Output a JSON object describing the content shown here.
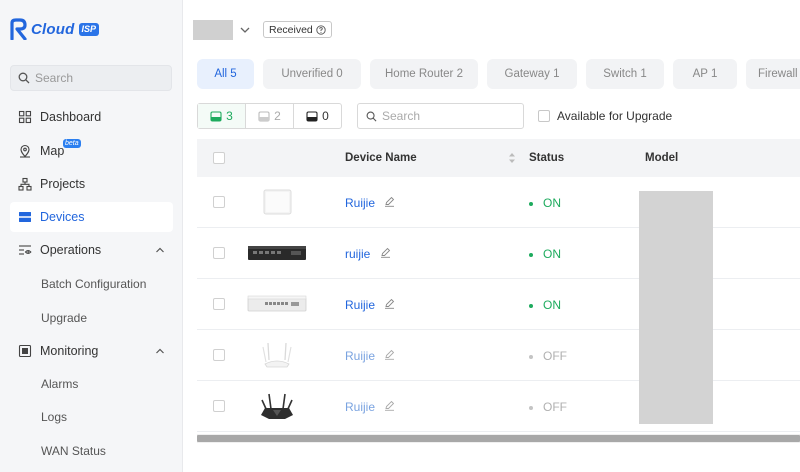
{
  "brand": {
    "name": "Cloud",
    "badge": "ISP",
    "color": "#2266dd"
  },
  "sidebar": {
    "search_placeholder": "Search",
    "items": [
      {
        "label": "Dashboard",
        "icon": "grid-icon"
      },
      {
        "label": "Map",
        "icon": "map-pin-icon",
        "badge": "beta"
      },
      {
        "label": "Projects",
        "icon": "hierarchy-icon"
      },
      {
        "label": "Devices",
        "icon": "devices-icon",
        "active": true
      },
      {
        "label": "Operations",
        "icon": "eye-settings-icon",
        "expanded": true
      },
      {
        "label": "Monitoring",
        "icon": "monitor-icon",
        "expanded": true
      }
    ],
    "operations_sub": [
      "Batch Configuration",
      "Upgrade"
    ],
    "monitoring_sub": [
      "Alarms",
      "Logs",
      "WAN Status"
    ]
  },
  "topbar": {
    "received_label": "Received"
  },
  "tabs": [
    {
      "label": "All 5",
      "active": true
    },
    {
      "label": "Unverified 0"
    },
    {
      "label": "Home Router 2"
    },
    {
      "label": "Gateway 1"
    },
    {
      "label": "Switch 1"
    },
    {
      "label": "AP 1"
    },
    {
      "label": "Firewall"
    }
  ],
  "filters": {
    "online_count": "3",
    "offline_count": "2",
    "abnormal_count": "0"
  },
  "search": {
    "placeholder": "Search"
  },
  "upgrade_filter": {
    "label": "Available for Upgrade"
  },
  "table": {
    "headers": {
      "name": "Device Name",
      "status": "Status",
      "model": "Model"
    },
    "rows": [
      {
        "name": "Ruijie",
        "status": "ON",
        "device": "ap-white"
      },
      {
        "name": "ruijie",
        "status": "ON",
        "device": "gateway-black"
      },
      {
        "name": "Ruijie",
        "status": "ON",
        "device": "switch-white"
      },
      {
        "name": "Ruijie",
        "status": "OFF",
        "device": "router-white"
      },
      {
        "name": "Ruijie",
        "status": "OFF",
        "device": "router-black"
      }
    ]
  },
  "colors": {
    "accent": "#2266dd",
    "online": "#1eab5e",
    "offline": "#b0b0b0"
  }
}
